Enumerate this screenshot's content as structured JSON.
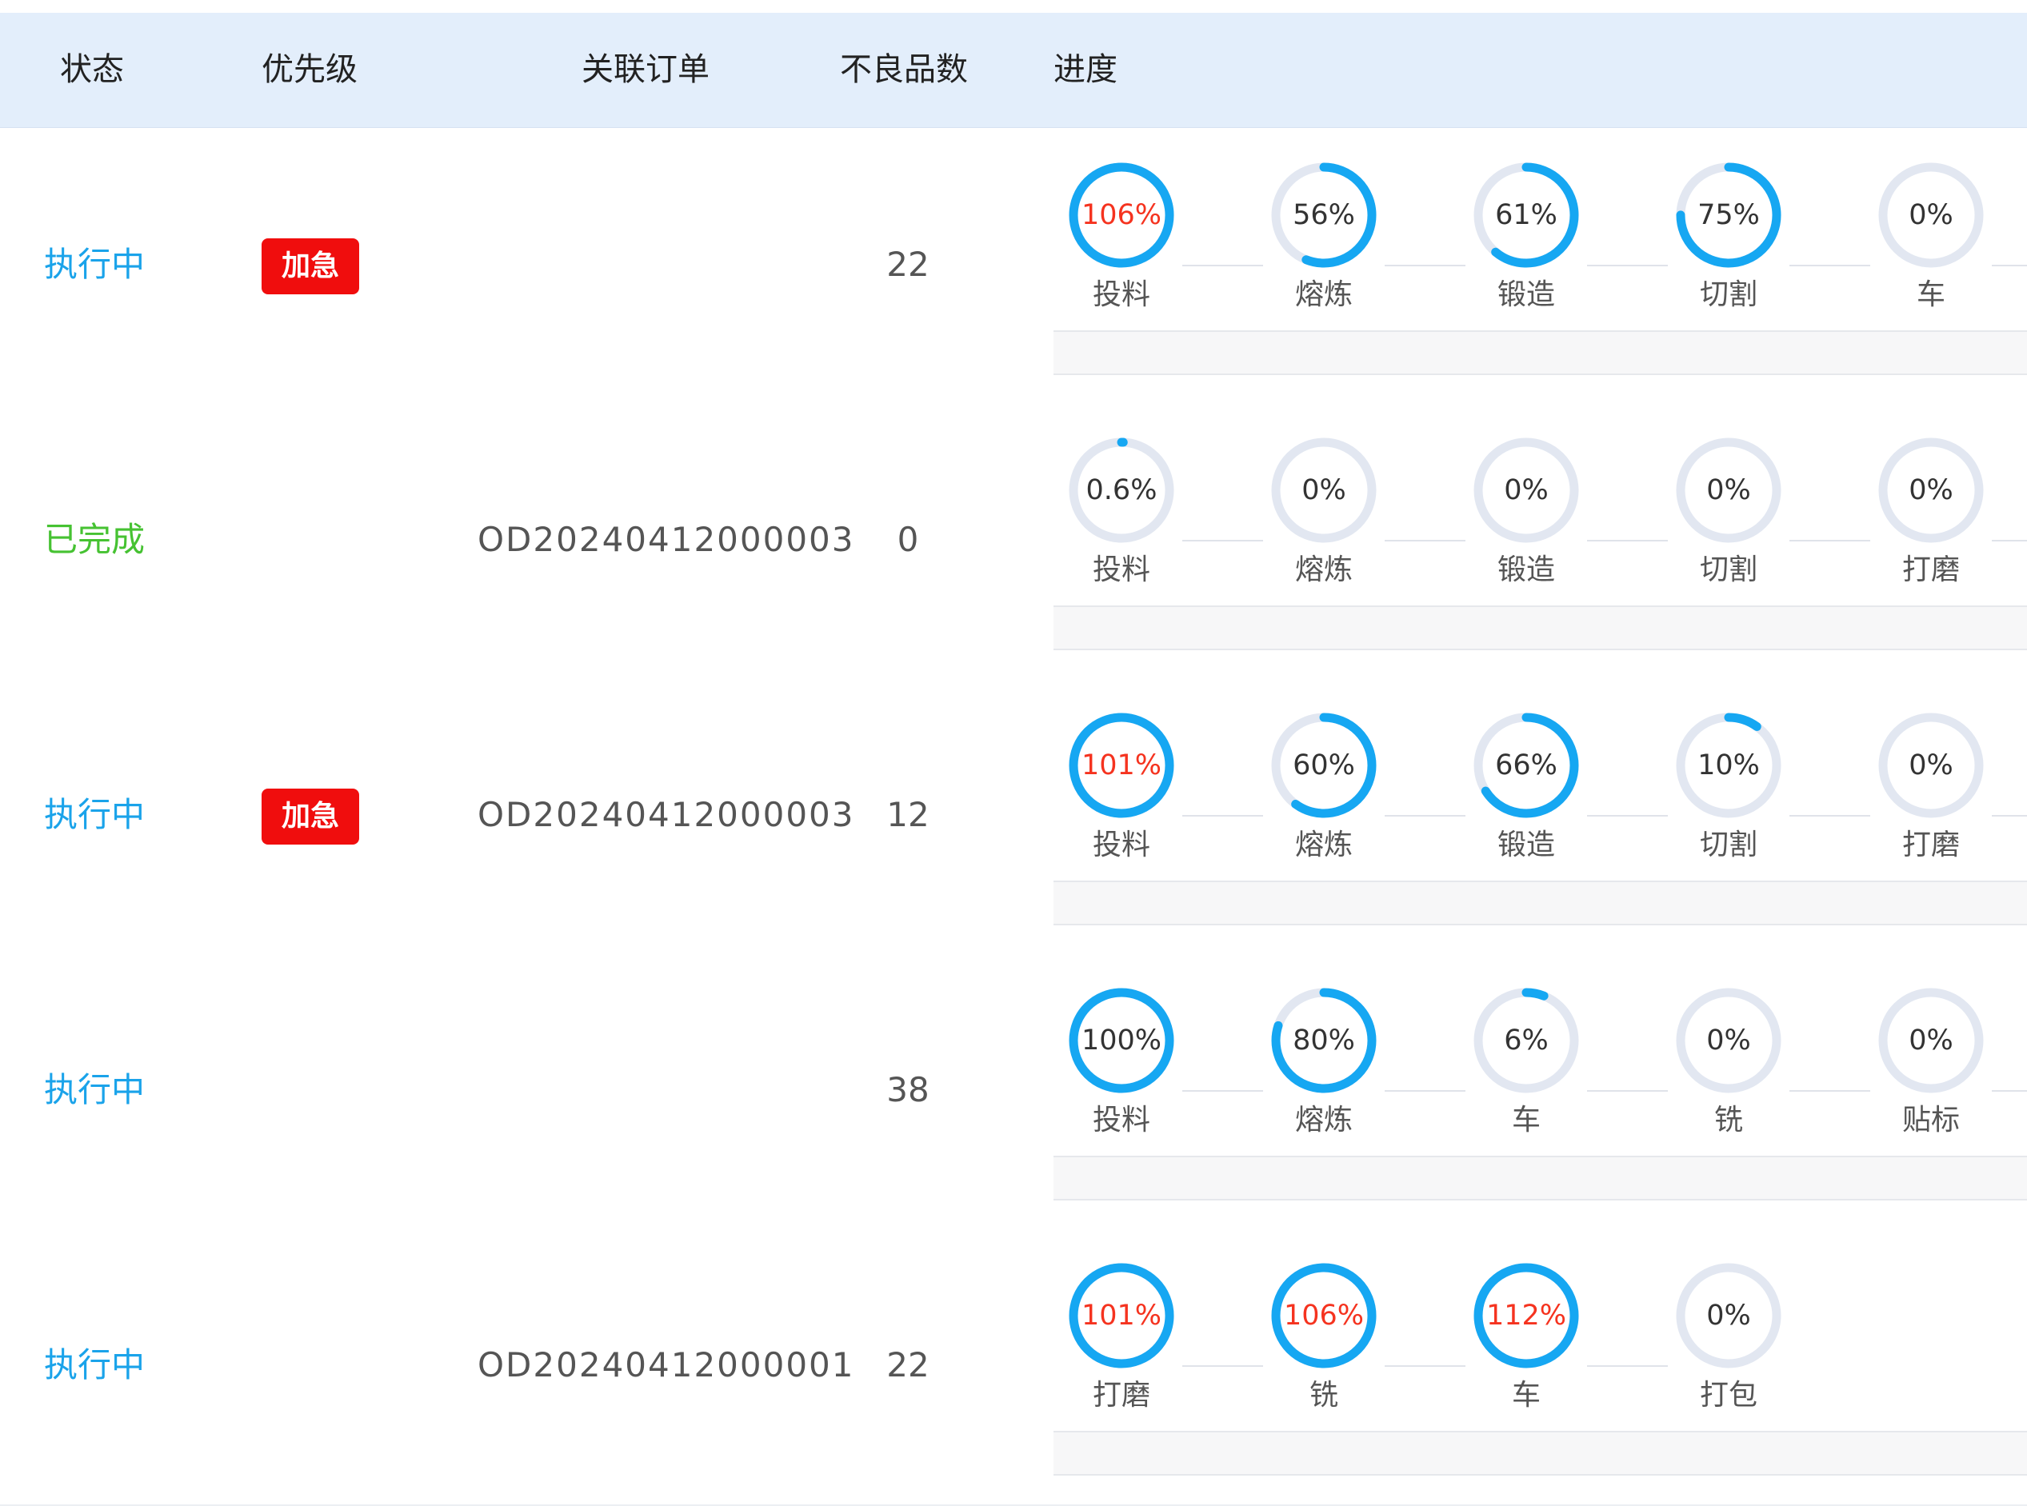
{
  "colors": {
    "ring_fill": "#16a7f2",
    "ring_track": "#e2e7f1",
    "over_text": "#f5331f",
    "status_running": "#1aa3ea",
    "status_done": "#46c232",
    "urgent_tag": "#f00d0d",
    "header_bg": "#e3eefb"
  },
  "columns": {
    "status": "状态",
    "priority": "优先级",
    "order": "关联订单",
    "defects": "不良品数",
    "progress": "进度"
  },
  "rows": [
    {
      "status": "执行中",
      "status_type": "running",
      "priority": "加急",
      "order": "",
      "defects": "22",
      "steps": [
        {
          "label": "投料",
          "percent": "106%",
          "value": 106
        },
        {
          "label": "熔炼",
          "percent": "56%",
          "value": 56
        },
        {
          "label": "锻造",
          "percent": "61%",
          "value": 61
        },
        {
          "label": "切割",
          "percent": "75%",
          "value": 75
        },
        {
          "label": "车",
          "percent": "0%",
          "value": 0
        }
      ]
    },
    {
      "status": "已完成",
      "status_type": "done",
      "priority": "",
      "order": "OD20240412000003",
      "defects": "0",
      "steps": [
        {
          "label": "投料",
          "percent": "0.6%",
          "value": 0.6
        },
        {
          "label": "熔炼",
          "percent": "0%",
          "value": 0
        },
        {
          "label": "锻造",
          "percent": "0%",
          "value": 0
        },
        {
          "label": "切割",
          "percent": "0%",
          "value": 0
        },
        {
          "label": "打磨",
          "percent": "0%",
          "value": 0
        }
      ]
    },
    {
      "status": "执行中",
      "status_type": "running",
      "priority": "加急",
      "order": "OD20240412000003",
      "defects": "12",
      "steps": [
        {
          "label": "投料",
          "percent": "101%",
          "value": 101
        },
        {
          "label": "熔炼",
          "percent": "60%",
          "value": 60
        },
        {
          "label": "锻造",
          "percent": "66%",
          "value": 66
        },
        {
          "label": "切割",
          "percent": "10%",
          "value": 10
        },
        {
          "label": "打磨",
          "percent": "0%",
          "value": 0
        }
      ]
    },
    {
      "status": "执行中",
      "status_type": "running",
      "priority": "",
      "order": "",
      "defects": "38",
      "steps": [
        {
          "label": "投料",
          "percent": "100%",
          "value": 100
        },
        {
          "label": "熔炼",
          "percent": "80%",
          "value": 80
        },
        {
          "label": "车",
          "percent": "6%",
          "value": 6
        },
        {
          "label": "铣",
          "percent": "0%",
          "value": 0
        },
        {
          "label": "贴标",
          "percent": "0%",
          "value": 0
        }
      ]
    },
    {
      "status": "执行中",
      "status_type": "running",
      "priority": "",
      "order": "OD20240412000001",
      "defects": "22",
      "steps": [
        {
          "label": "打磨",
          "percent": "101%",
          "value": 101
        },
        {
          "label": "铣",
          "percent": "106%",
          "value": 106
        },
        {
          "label": "车",
          "percent": "112%",
          "value": 112
        },
        {
          "label": "打包",
          "percent": "0%",
          "value": 0
        }
      ]
    }
  ]
}
